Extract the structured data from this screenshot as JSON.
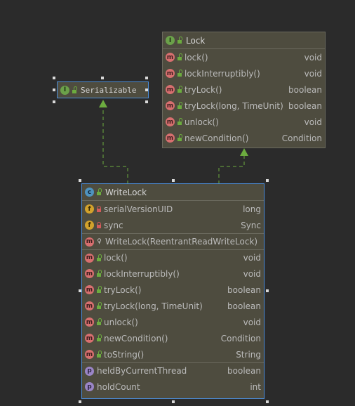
{
  "lock": {
    "title": "Lock",
    "members": [
      {
        "name": "lock()",
        "type": "void"
      },
      {
        "name": "lockInterruptibly()",
        "type": "void"
      },
      {
        "name": "tryLock()",
        "type": "boolean"
      },
      {
        "name": "tryLock(long, TimeUnit)",
        "type": "boolean"
      },
      {
        "name": "unlock()",
        "type": "void"
      },
      {
        "name": "newCondition()",
        "type": "Condition"
      }
    ]
  },
  "serializable": {
    "title": "Serializable"
  },
  "writelock": {
    "title": "WriteLock",
    "fields": [
      {
        "name": "serialVersionUID",
        "type": "long"
      },
      {
        "name": "sync",
        "type": "Sync"
      }
    ],
    "constructor": {
      "name": "WriteLock(ReentrantReadWriteLock)",
      "type": ""
    },
    "methods": [
      {
        "name": "lock()",
        "type": "void"
      },
      {
        "name": "lockInterruptibly()",
        "type": "void"
      },
      {
        "name": "tryLock()",
        "type": "boolean"
      },
      {
        "name": "tryLock(long, TimeUnit)",
        "type": "boolean"
      },
      {
        "name": "unlock()",
        "type": "void"
      },
      {
        "name": "newCondition()",
        "type": "Condition"
      },
      {
        "name": "toString()",
        "type": "String"
      }
    ],
    "properties": [
      {
        "name": "heldByCurrentThread",
        "type": "boolean"
      },
      {
        "name": "holdCount",
        "type": "int"
      }
    ]
  },
  "badges": {
    "method": "m",
    "field": "f",
    "property": "p",
    "interface": "I",
    "class": "c"
  },
  "colors": {
    "background": "#2b2b2b",
    "box": "#4e4c3f",
    "selection_border": "#4b8dd8",
    "arrow": "#6cac3f"
  }
}
